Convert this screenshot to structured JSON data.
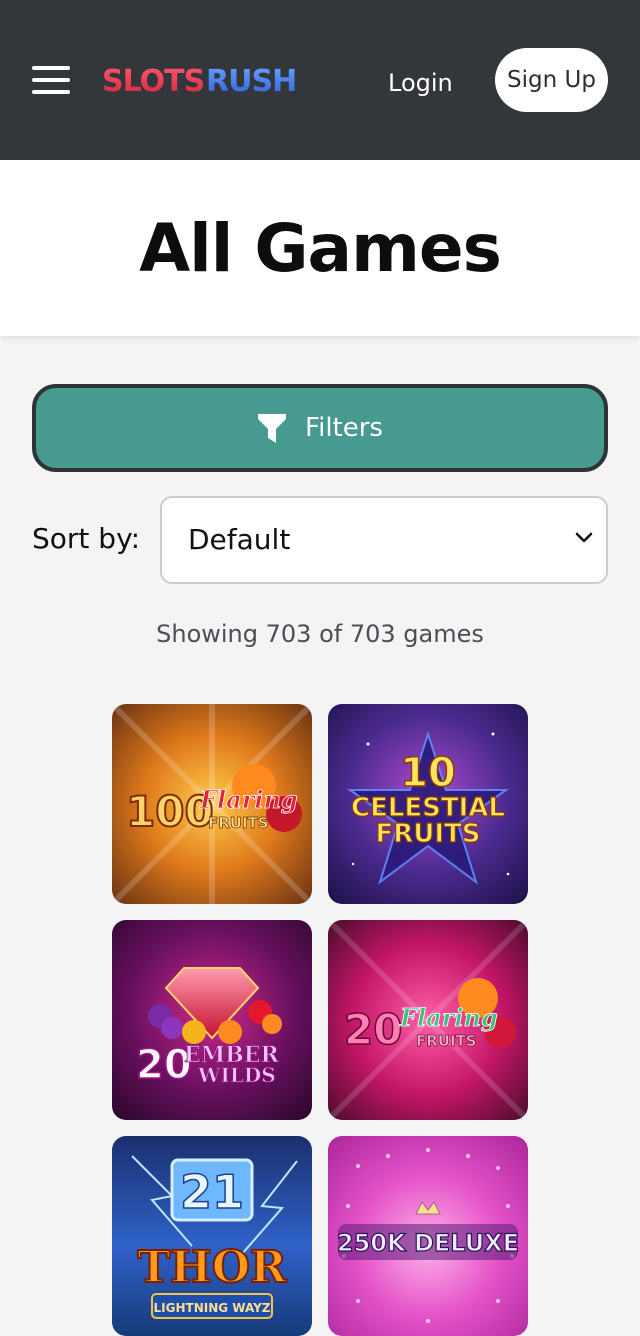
{
  "header": {
    "logo_text": "SLOTSRUSH",
    "login_label": "Login",
    "signup_label": "Sign Up"
  },
  "page": {
    "title": "All Games"
  },
  "filters": {
    "label": "Filters"
  },
  "sort": {
    "label": "Sort by:",
    "selected": "Default"
  },
  "results": {
    "showing_text": "Showing 703 of 703 games"
  },
  "games": [
    {
      "title_line1": "100",
      "title_line2": "Flaring",
      "title_line3": "FRUITS"
    },
    {
      "title_line1": "10",
      "title_line2": "CELESTIAL",
      "title_line3": "FRUITS"
    },
    {
      "title_line1": "20",
      "title_line2": "EMBER",
      "title_line3": "WILDS"
    },
    {
      "title_line1": "20",
      "title_line2": "Flaring",
      "title_line3": "FRUITS"
    },
    {
      "title_line1": "21",
      "title_line2": "THOR",
      "title_line3": "LIGHTNING WAYZ"
    },
    {
      "title_line1": "250K DELUXE"
    }
  ],
  "colors": {
    "header_bg": "#33373b",
    "filters_bg": "#469a8f",
    "accent_teal": "#469a8f"
  }
}
